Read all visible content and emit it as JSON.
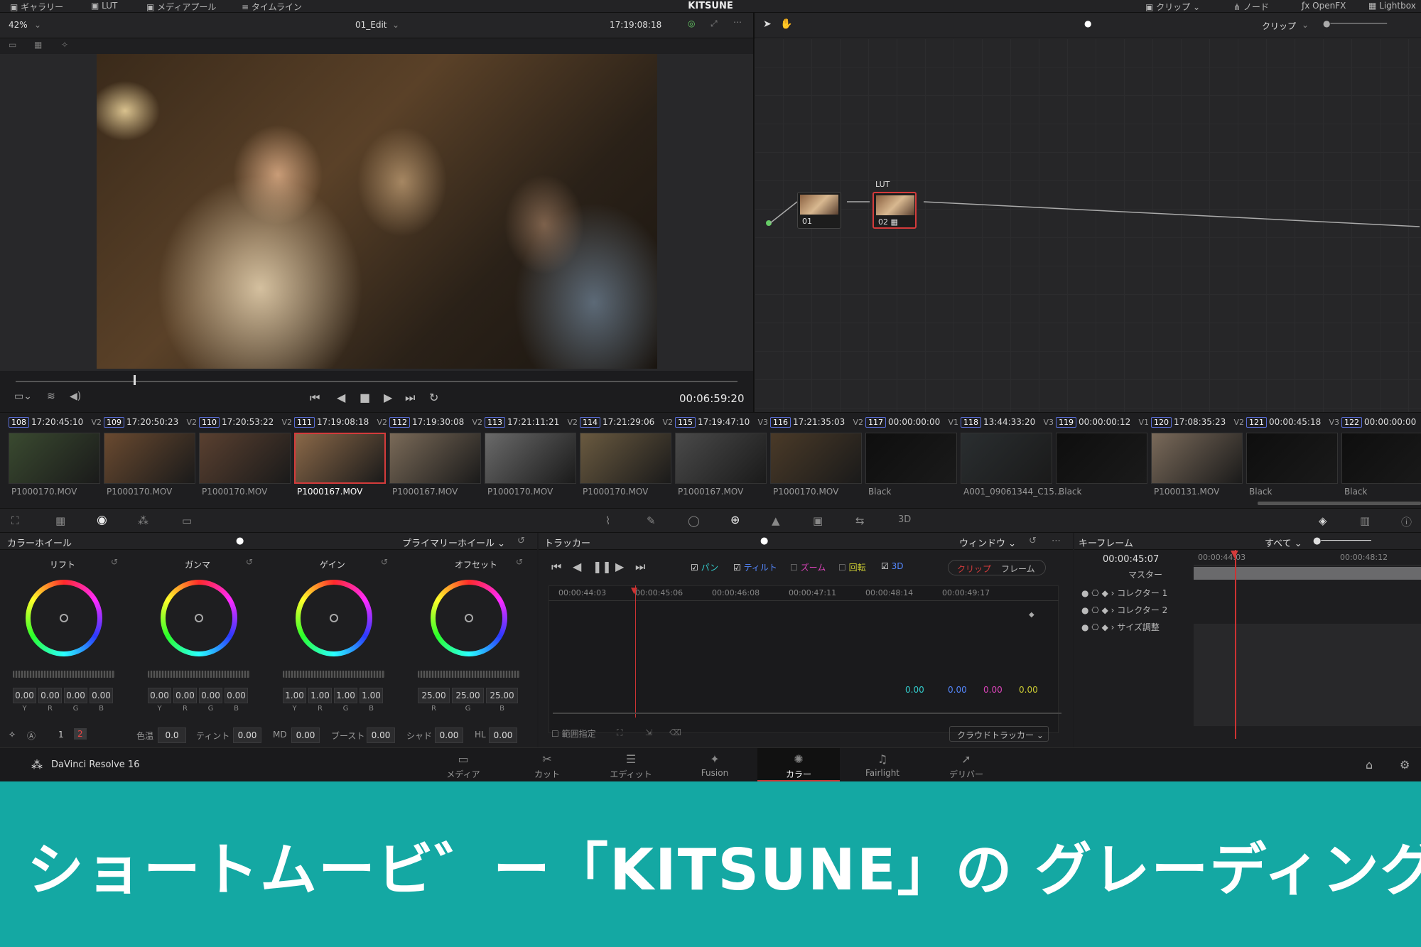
{
  "topbar": {
    "items_left": [
      "ギャラリー",
      "LUT",
      "メディアプール",
      "タイムライン"
    ],
    "title": "KITSUNE",
    "items_right": [
      "クリップ",
      "ノード",
      "OpenFX",
      "Lightbox"
    ]
  },
  "viewer": {
    "zoom": "42%",
    "timeline_name": "01_Edit",
    "source_timecode": "17:19:08:18",
    "playback_timecode": "00:06:59:20"
  },
  "nodes": {
    "mode_label": "クリップ",
    "node1_label": "01",
    "node2_label": "02",
    "node2_title": "LUT"
  },
  "clips": [
    {
      "num": "108",
      "tc": "17:20:45:10",
      "track": "V2",
      "name": "P1000170.MOV",
      "color": "#3a4a30"
    },
    {
      "num": "109",
      "tc": "17:20:50:23",
      "track": "V2",
      "name": "P1000170.MOV",
      "color": "#6a4a30"
    },
    {
      "num": "110",
      "tc": "17:20:53:22",
      "track": "V2",
      "name": "P1000170.MOV",
      "color": "#5a4030"
    },
    {
      "num": "111",
      "tc": "17:19:08:18",
      "track": "V2",
      "name": "P1000167.MOV",
      "color": "#8a6848",
      "selected": true
    },
    {
      "num": "112",
      "tc": "17:19:30:08",
      "track": "V2",
      "name": "P1000167.MOV",
      "color": "#7a6a58"
    },
    {
      "num": "113",
      "tc": "17:21:11:21",
      "track": "V2",
      "name": "P1000170.MOV",
      "color": "#6a6a6a"
    },
    {
      "num": "114",
      "tc": "17:21:29:06",
      "track": "V2",
      "name": "P1000170.MOV",
      "color": "#6a5a40"
    },
    {
      "num": "115",
      "tc": "17:19:47:10",
      "track": "V3",
      "name": "P1000167.MOV",
      "color": "#4a4a4a"
    },
    {
      "num": "116",
      "tc": "17:21:35:03",
      "track": "V2",
      "name": "P1000170.MOV",
      "color": "#4a3a28"
    },
    {
      "num": "117",
      "tc": "00:00:00:00",
      "track": "V1",
      "name": "Black",
      "color": "#0e0e0e"
    },
    {
      "num": "118",
      "tc": "13:44:33:20",
      "track": "V3",
      "name": "A001_09061344_C15...",
      "color": "#2a2e30"
    },
    {
      "num": "119",
      "tc": "00:00:00:12",
      "track": "V1",
      "name": "Black",
      "color": "#0e0e0e"
    },
    {
      "num": "120",
      "tc": "17:08:35:23",
      "track": "V2",
      "name": "P1000131.MOV",
      "color": "#7a6a5a"
    },
    {
      "num": "121",
      "tc": "00:00:45:18",
      "track": "V3",
      "name": "Black",
      "color": "#0e0e0e"
    },
    {
      "num": "122",
      "tc": "00:00:00:00",
      "track": "",
      "name": "Black",
      "color": "#0e0e0e"
    }
  ],
  "color_wheels": {
    "title": "カラーホイール",
    "mode": "プライマリーホイール",
    "wheels": [
      {
        "label": "リフト",
        "values": [
          "0.00",
          "0.00",
          "0.00",
          "0.00"
        ]
      },
      {
        "label": "ガンマ",
        "values": [
          "0.00",
          "0.00",
          "0.00",
          "0.00"
        ]
      },
      {
        "label": "ゲイン",
        "values": [
          "1.00",
          "1.00",
          "1.00",
          "1.00"
        ]
      },
      {
        "label": "オフセット",
        "values": [
          "25.00",
          "25.00",
          "25.00"
        ]
      }
    ],
    "channels4": [
      "Y",
      "R",
      "G",
      "B"
    ],
    "channels3": [
      "R",
      "G",
      "B"
    ],
    "page1": "1",
    "page2": "2",
    "bottom": {
      "temp_label": "色温",
      "temp_value": "0.0",
      "tint_label": "ティント",
      "tint_value": "0.00",
      "md_label": "MD",
      "md_value": "0.00",
      "boost_label": "ブースト",
      "boost_value": "0.00",
      "shad_label": "シャド",
      "shad_value": "0.00",
      "hl_label": "HL",
      "hl_value": "0.00"
    }
  },
  "tracker": {
    "title": "トラッカー",
    "window_label": "ウィンドウ",
    "checks": [
      "パン",
      "ティルト",
      "ズーム",
      "回転",
      "3D"
    ],
    "clip_btn": "クリップ",
    "frame_btn": "フレーム",
    "ruler": [
      "00:00:44:03",
      "00:00:45:06",
      "00:00:46:08",
      "00:00:47:11",
      "00:00:48:14",
      "00:00:49:17"
    ],
    "readouts": [
      "0.00",
      "0.00",
      "0.00",
      "0.00"
    ],
    "range_label": "範囲指定",
    "cloud_label": "クラウドトラッカー"
  },
  "keyframes": {
    "title": "キーフレーム",
    "filter": "すべて",
    "current_tc": "00:00:45:07",
    "ruler_a": "00:00:44:03",
    "ruler_b": "00:00:48:12",
    "master": "マスター",
    "rows": [
      "コレクター 1",
      "コレクター 2",
      "サイズ調整"
    ]
  },
  "pages": [
    {
      "label": "メディア",
      "icon": "▭"
    },
    {
      "label": "カット",
      "icon": "✂"
    },
    {
      "label": "エディット",
      "icon": "☰"
    },
    {
      "label": "Fusion",
      "icon": "✦"
    },
    {
      "label": "カラー",
      "icon": "✺",
      "active": true
    },
    {
      "label": "Fairlight",
      "icon": "♫"
    },
    {
      "label": "デリバー",
      "icon": "➚"
    }
  ],
  "app_name": "DaVinci Resolve 16",
  "banner_text": "ショートムービ゛ー「KITSUNE」の グレーディング",
  "colors": {
    "banner": "#14a8a3",
    "accent_red": "#d43b3b",
    "clip_num_border": "#5a6fd8"
  }
}
